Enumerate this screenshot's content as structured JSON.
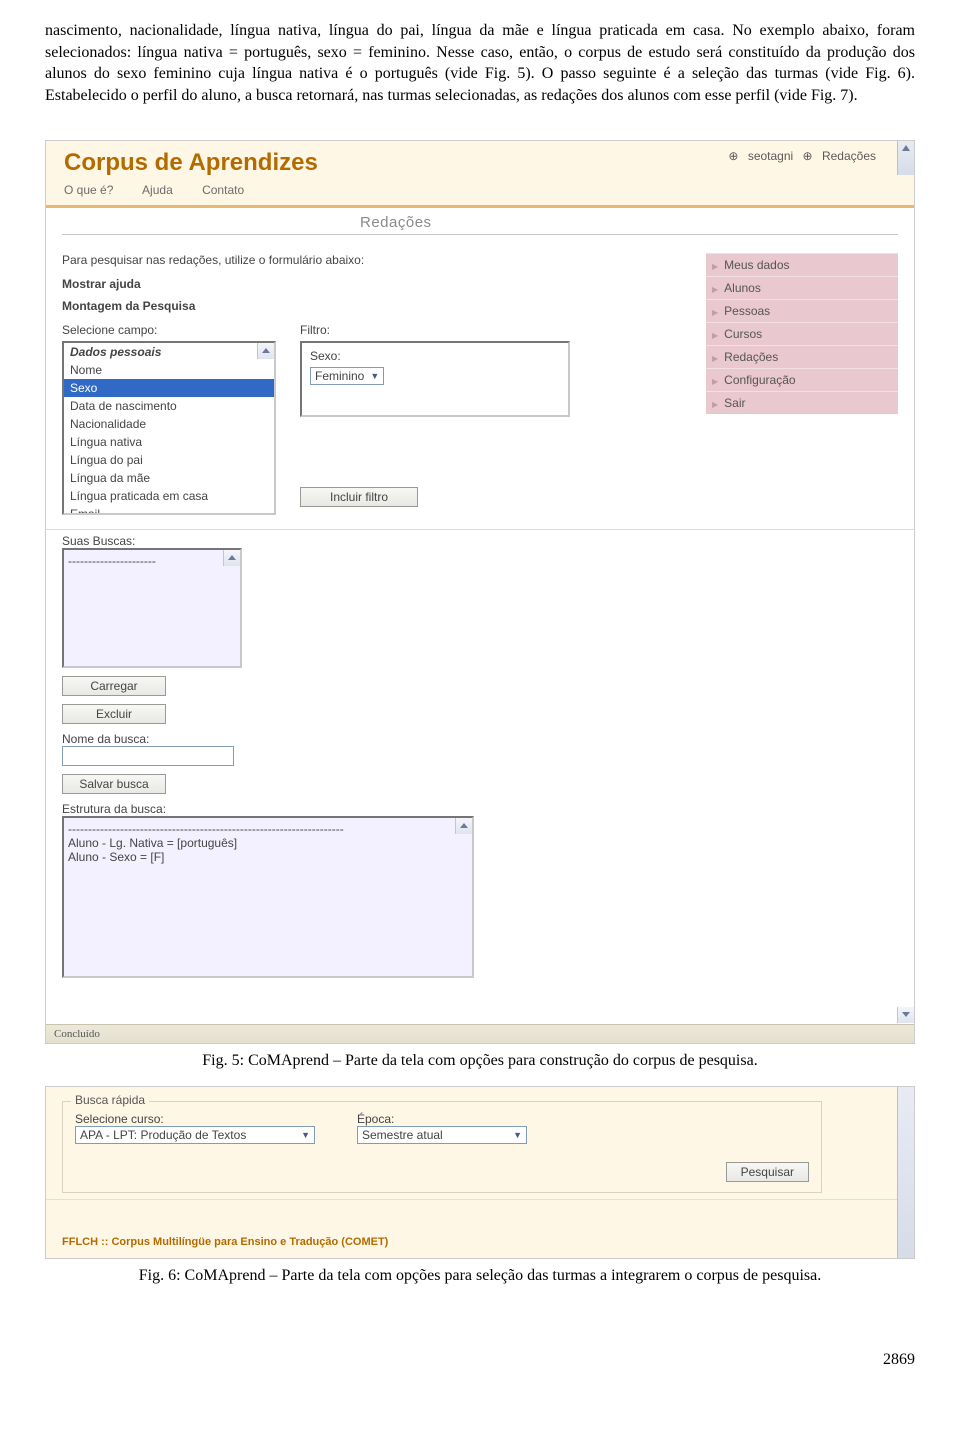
{
  "paper": {
    "paragraph": "nascimento, nacionalidade, língua nativa, língua do pai, língua da mãe e língua praticada em casa. No exemplo abaixo, foram selecionados: língua nativa = português, sexo = feminino. Nesse caso, então, o corpus de estudo será constituído da produção dos alunos do sexo feminino cuja língua nativa é o português (vide Fig. 5). O passo seguinte é a seleção das turmas (vide Fig. 6). Estabelecido o perfil do aluno, a busca retornará, nas turmas selecionadas, as redações dos alunos com esse perfil (vide Fig. 7).",
    "caption5": "Fig. 5: CoMAprend – Parte da tela com opções para construção do corpus de pesquisa.",
    "caption6": "Fig. 6: CoMAprend – Parte da tela com opções para seleção das turmas a integrarem o corpus de pesquisa.",
    "pagenum": "2869"
  },
  "shot1": {
    "logo": "Corpus de Aprendizes",
    "toplinks": {
      "user": "seotagni",
      "redacoes": "Redações"
    },
    "nav": [
      "O que é?",
      "Ajuda",
      "Contato"
    ],
    "subhead": "Redações",
    "intro": "Para pesquisar nas redações, utilize o formulário abaixo:",
    "showhelp": "Mostrar ajuda",
    "mp": "Montagem da Pesquisa",
    "selcampo_label": "Selecione campo:",
    "filtro_label": "Filtro:",
    "fields": {
      "header": "Dados pessoais",
      "items": [
        "Nome",
        "Sexo",
        "Data de nascimento",
        "Nacionalidade",
        "Língua nativa",
        "Língua do pai",
        "Língua da mãe",
        "Língua praticada em casa",
        "Email"
      ]
    },
    "sexo_label": "Sexo:",
    "sexo_value": "Feminino",
    "incluir": "Incluir filtro",
    "side": [
      "Meus dados",
      "Alunos",
      "Pessoas",
      "Cursos",
      "Redações",
      "Configuração",
      "Sair"
    ],
    "suasbuscas": "Suas Buscas:",
    "dashes": "----------------------",
    "carregar": "Carregar",
    "excluir": "Excluir",
    "nomebusca": "Nome da busca:",
    "salvar": "Salvar busca",
    "estrutura": "Estrutura da busca:",
    "eb1": "---------------------------------------------------------------------",
    "eb2": "Aluno - Lg. Nativa = [português]",
    "eb3": "Aluno - Sexo = [F]",
    "status": "Concluído"
  },
  "shot2": {
    "legend": "Busca rápida",
    "selcurso": "Selecione curso:",
    "curso": "APA - LPT: Produção de Textos",
    "epoca_label": "Época:",
    "epoca": "Semestre atual",
    "pesquisar": "Pesquisar",
    "footer": "FFLCH :: Corpus Multilíngüe para Ensino e Tradução (COMET)"
  }
}
